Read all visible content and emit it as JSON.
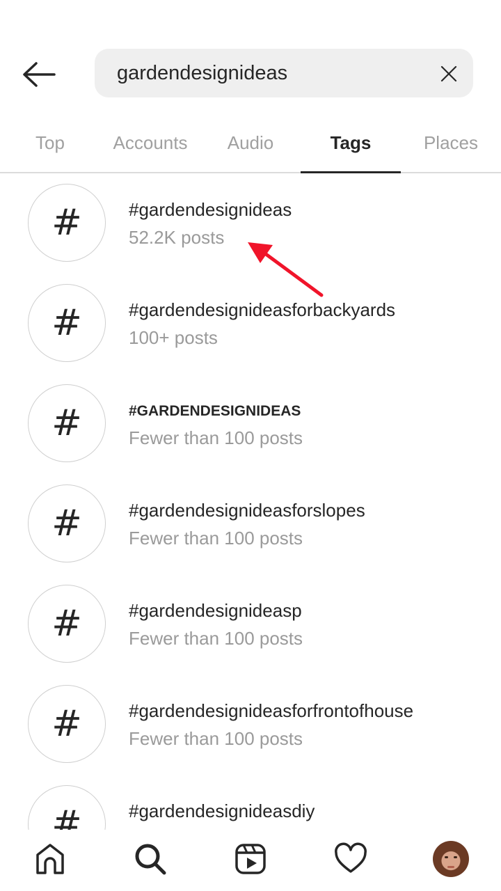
{
  "header": {
    "back_icon": "arrow-left-icon",
    "search_value": "gardendesignideas",
    "clear_icon": "close-icon"
  },
  "tabs": [
    {
      "label": "Top",
      "active": false
    },
    {
      "label": "Accounts",
      "active": false
    },
    {
      "label": "Audio",
      "active": false
    },
    {
      "label": "Tags",
      "active": true
    },
    {
      "label": "Places",
      "active": false
    }
  ],
  "results": [
    {
      "icon": "#",
      "name": "#gardendesignideas",
      "count": "52.2K posts"
    },
    {
      "icon": "#",
      "name": "#gardendesignideasforbackyards",
      "count": "100+ posts"
    },
    {
      "icon": "#",
      "name": "#GARDENDESIGNIDEAS",
      "count": "Fewer than 100 posts"
    },
    {
      "icon": "#",
      "name": "#gardendesignideasforslopes",
      "count": "Fewer than 100 posts"
    },
    {
      "icon": "#",
      "name": "#gardendesignideasp",
      "count": "Fewer than 100 posts"
    },
    {
      "icon": "#",
      "name": "#gardendesignideasforfrontofhouse",
      "count": "Fewer than 100 posts"
    },
    {
      "icon": "#",
      "name": "#gardendesignideasdiy",
      "count": ""
    }
  ],
  "annotation": {
    "type": "arrow",
    "color": "#f0142a",
    "points_to": "52.2K posts"
  },
  "bottom_nav": [
    {
      "icon": "home-icon"
    },
    {
      "icon": "search-icon",
      "active": true
    },
    {
      "icon": "reels-icon"
    },
    {
      "icon": "heart-icon"
    },
    {
      "icon": "profile-avatar"
    }
  ]
}
